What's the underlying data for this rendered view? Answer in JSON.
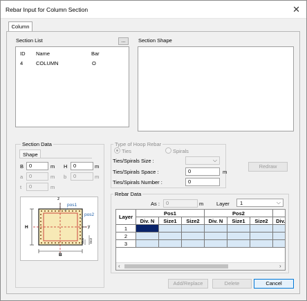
{
  "window": {
    "title": "Rebar Input for Column Section",
    "close_glyph": "✕"
  },
  "tabs": [
    {
      "label": "Column"
    }
  ],
  "section_list": {
    "label": "Section List",
    "more_button": "...",
    "columns": [
      "ID",
      "Name",
      "Bar"
    ],
    "rows": [
      {
        "id": "4",
        "name": "COLUMN",
        "bar": "O"
      }
    ]
  },
  "section_shape": {
    "label": "Section Shape"
  },
  "section_data": {
    "label": "Section Data",
    "shape_label": "Shape",
    "b_label": "B",
    "b_value": "0",
    "b_unit": "m",
    "h_label": "H",
    "h_value": "0",
    "h_unit": "m",
    "a_label": "a",
    "a_value": "0",
    "a_unit": "m",
    "bb_label": "b",
    "bb_value": "0",
    "bb_unit": "m",
    "t_label": "t",
    "t_value": "0",
    "t_unit": "m"
  },
  "diagram": {
    "z_label": "z",
    "y_label": "y",
    "pos1_label": "pos1",
    "pos2_label": "pos2",
    "h_label": "H",
    "b_label": "B",
    "dc1_label": "Dc1",
    "dc2_label": "Dc2"
  },
  "hoop": {
    "label": "Type of Hoop Rebar",
    "ties_label": "Ties",
    "spirals_label": "Spirals",
    "size_label": "Ties/Spirals Size :",
    "space_label": "Ties/Spirals Space :",
    "space_value": "0",
    "space_unit": "m",
    "number_label": "Ties/Spirals Number :",
    "number_value": "0",
    "redraw_button": "Redraw"
  },
  "rebar_data": {
    "label": "Rebar Data",
    "as_label": "As :",
    "as_value": "0",
    "as_unit": "m",
    "layer_label": "Layer",
    "layer_value": "1",
    "table": {
      "corner": "Layer",
      "groups": [
        "Pos1",
        "Pos2"
      ],
      "sub_headers": [
        "Div. N",
        "Size1",
        "Size2",
        "Div. N",
        "Size1",
        "Size2",
        "Div. N"
      ],
      "rows": [
        "1",
        "2",
        "3"
      ]
    }
  },
  "footer": {
    "add_replace": "Add/Replace",
    "delete": "Delete",
    "cancel": "Cancel"
  }
}
